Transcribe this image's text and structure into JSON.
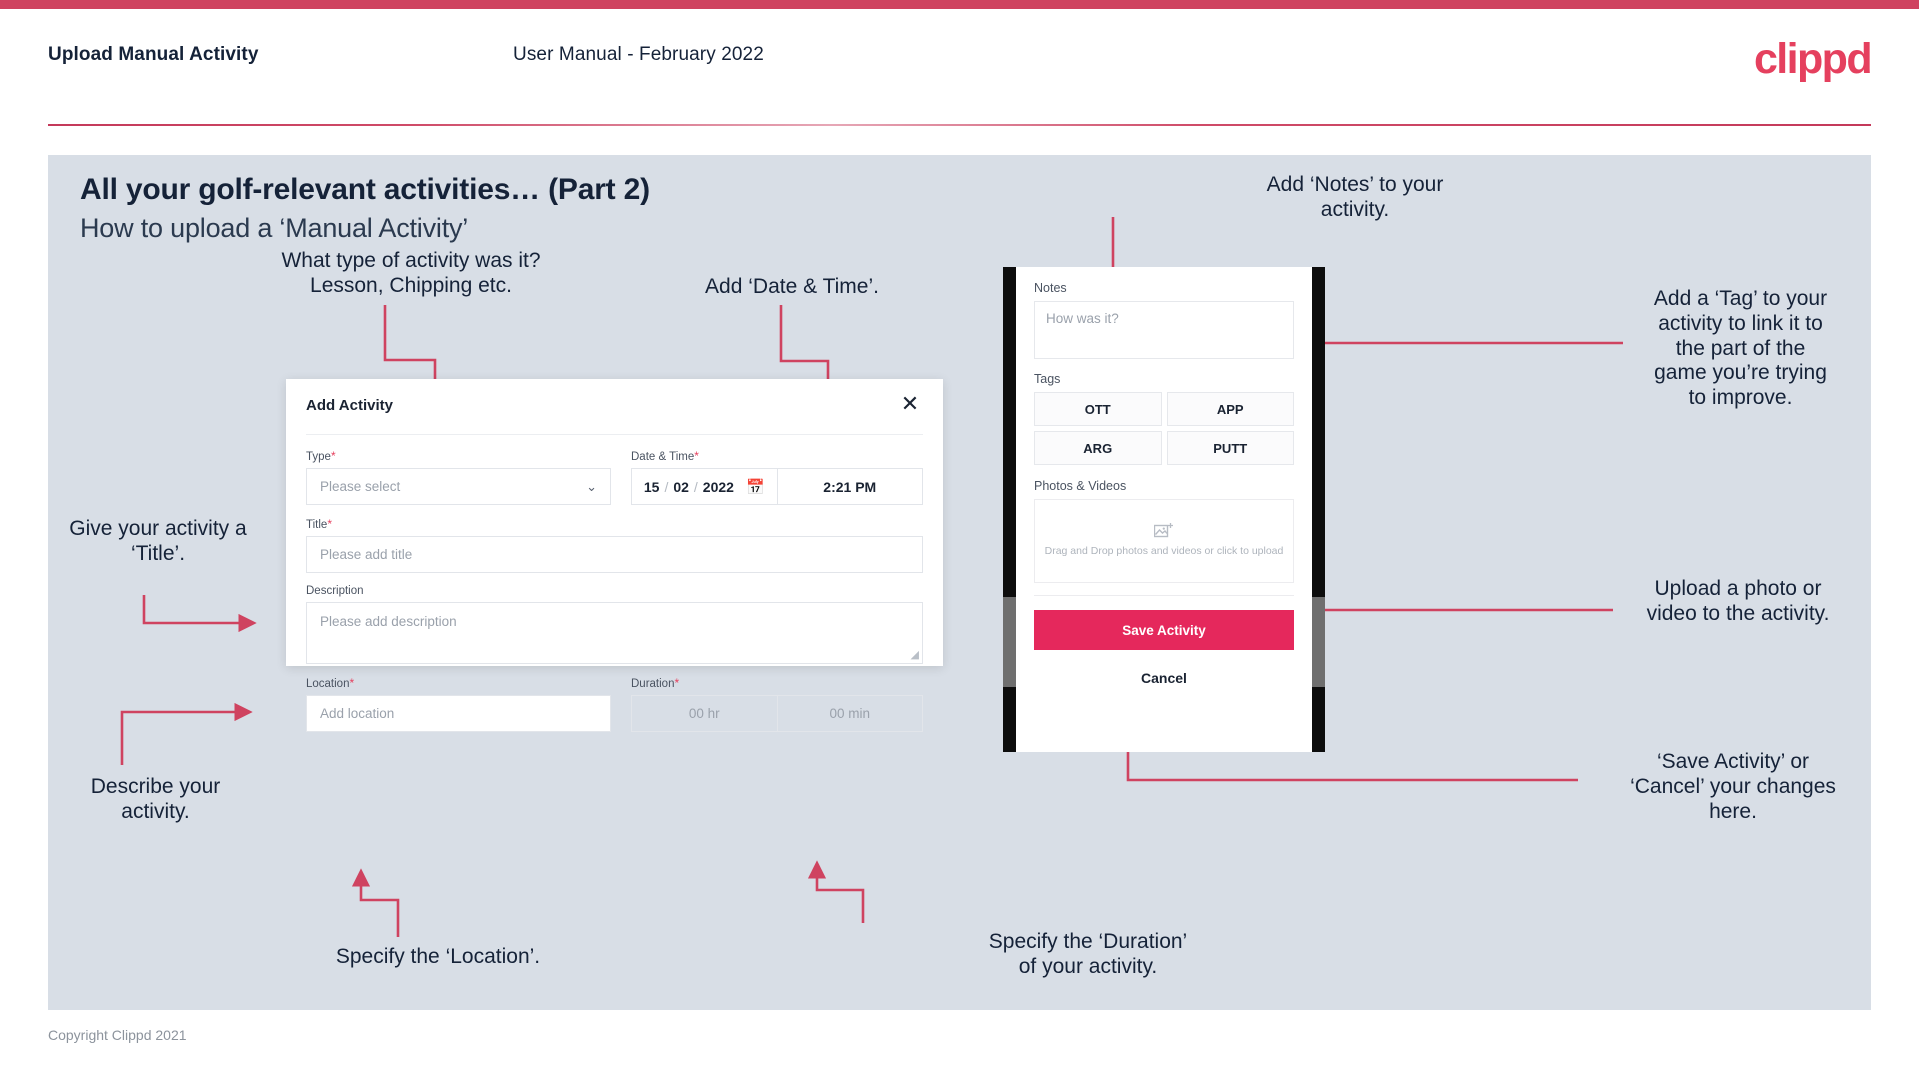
{
  "header": {
    "title": "Upload Manual Activity",
    "subtitle": "User Manual - February 2022",
    "brand": "clippd"
  },
  "slide": {
    "title": "All your golf-relevant activities… (Part 2)",
    "subtitle": "How to upload a ‘Manual Activity’"
  },
  "annotations": {
    "type": "What type of activity was it?\nLesson, Chipping etc.",
    "datetime": "Add ‘Date & Time’.",
    "title": "Give your activity a\n‘Title’.",
    "describe": "Describe your\nactivity.",
    "location": "Specify the ‘Location’.",
    "duration": "Specify the ‘Duration’\nof your activity.",
    "notes": "Add ‘Notes’ to your\nactivity.",
    "tag": "Add a ‘Tag’ to your\nactivity to link it to\nthe part of the\ngame you’re trying\nto improve.",
    "upload": "Upload a photo or\nvideo to the activity.",
    "save": "‘Save Activity’ or\n‘Cancel’ your changes\nhere."
  },
  "dialog": {
    "title": "Add Activity",
    "close_icon": "✕",
    "fields": {
      "type": {
        "label": "Type",
        "required": "*",
        "placeholder": "Please select",
        "chevron": "⌄"
      },
      "datetime": {
        "label": "Date & Time",
        "required": "*",
        "day": "15",
        "month": "02",
        "year": "2022",
        "sep": "/",
        "time": "2:21 PM"
      },
      "title": {
        "label": "Title",
        "required": "*",
        "placeholder": "Please add title"
      },
      "description": {
        "label": "Description",
        "placeholder": "Please add description"
      },
      "location": {
        "label": "Location",
        "required": "*",
        "placeholder": "Add location"
      },
      "duration": {
        "label": "Duration",
        "required": "*",
        "hours": "00 hr",
        "minutes": "00 min"
      }
    }
  },
  "phone": {
    "notes": {
      "label": "Notes",
      "placeholder": "How was it?"
    },
    "tags": {
      "label": "Tags",
      "items": [
        "OTT",
        "APP",
        "ARG",
        "PUTT"
      ]
    },
    "photos": {
      "label": "Photos & Videos",
      "dropzone_text": "Drag and Drop photos and videos or click to upload"
    },
    "save_label": "Save Activity",
    "cancel_label": "Cancel"
  },
  "footer": {
    "copyright": "Copyright Clippd 2021"
  },
  "colors": {
    "accent": "#e5405e",
    "accent_dark": "#cf4360",
    "save_button": "#e5285c",
    "slide_bg": "#d8dee6",
    "text_dark": "#152238"
  }
}
